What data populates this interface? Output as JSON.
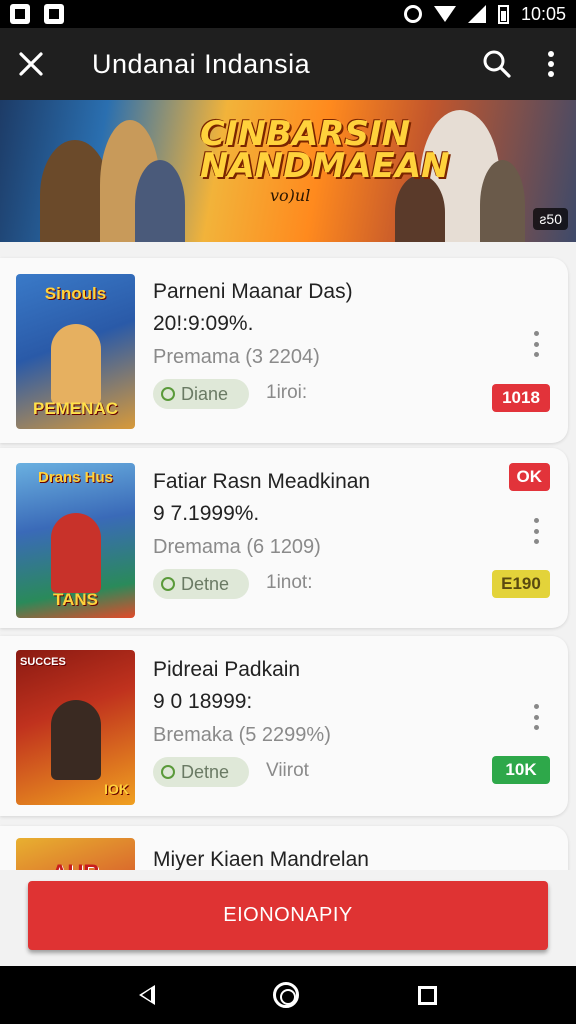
{
  "status_bar": {
    "time": "10:05"
  },
  "app_bar": {
    "title": "Undanai Indansia"
  },
  "banner": {
    "title": "CINBARSIN NANDMAEAN",
    "subtitle": "vo)ul",
    "badge": "ƨ50"
  },
  "list": [
    {
      "thumb_top": "Sinouls",
      "thumb_bottom": "PEMENAC",
      "title": "Parneni Maanar Das)",
      "value": "20!:9:09%.",
      "subtitle": "Premama  (3 2204)",
      "tag": "Diane",
      "meta": "1iroi:",
      "badge": "1018",
      "badge_color": "#e2333a",
      "colors": [
        "#2a5aa8",
        "#d89a3a"
      ]
    },
    {
      "thumb_top": "Drans Hus",
      "thumb_bottom": "TANS",
      "title": "Fatiar Rasn Meadkinan",
      "value": "9 7.1999%.",
      "subtitle": "Dremama  (6 1209)",
      "tag": "Detne",
      "meta": "1inot:",
      "badge": "E190",
      "badge_color": "#e3d33a",
      "badge_top": "OK",
      "colors": [
        "#3a6ab8",
        "#e24a2a"
      ]
    },
    {
      "thumb_top": "SUCCES",
      "thumb_bottom": "IOK",
      "title": "Pidreai Padkain",
      "value": "9 0 18999:",
      "subtitle": "Bremaka  (5 2299%)",
      "tag": "Detne",
      "meta": "Viirot",
      "badge": "10K",
      "badge_color": "#2ea84a",
      "colors": [
        "#c0321e",
        "#f0a020"
      ]
    },
    {
      "thumb_top": "AUR",
      "title": "Miyer Kiaen Mandrelan",
      "colors": [
        "#e8b030",
        "#d2402a"
      ]
    }
  ],
  "cta": {
    "label": "EIONONAPIY"
  },
  "nav": {
    "back": "back-icon",
    "home": "home-icon",
    "recents": "recents-icon"
  },
  "theme": {
    "appbar": "#1f1f1f",
    "accent": "#df3333"
  }
}
